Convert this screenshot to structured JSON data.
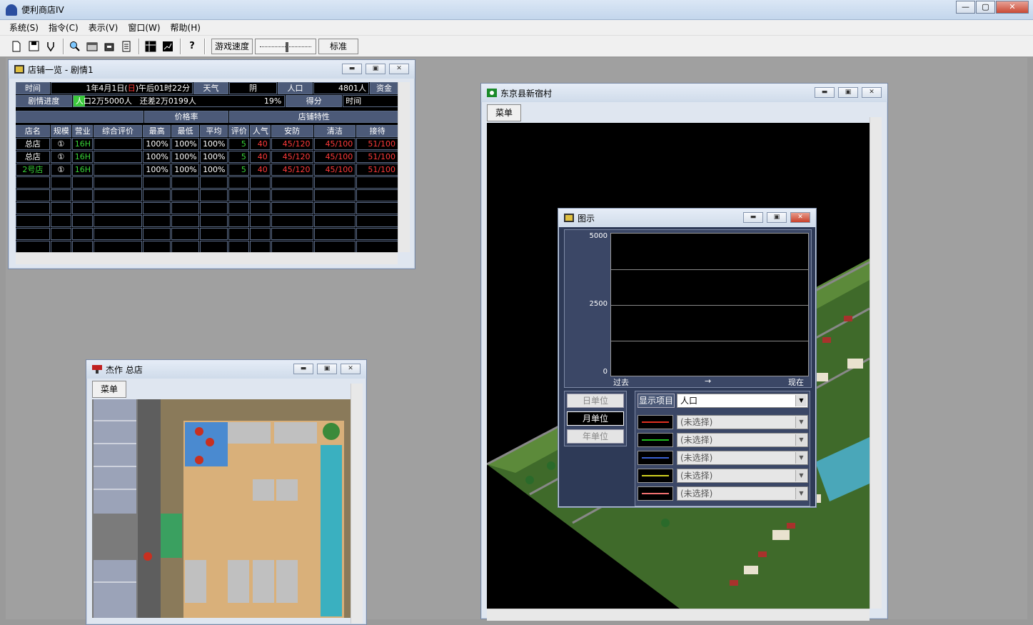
{
  "app": {
    "title": "便利商店IV",
    "window_buttons": [
      "—",
      "▢",
      "✕"
    ]
  },
  "menu": [
    "系统(S)",
    "指令(C)",
    "表示(V)",
    "窗口(W)",
    "帮助(H)"
  ],
  "toolbar": {
    "speed_label": "游戏速度",
    "speed_value": "标准",
    "speed_level": 0.5
  },
  "store_list": {
    "title": "店铺一览 - 剧情1",
    "row1": [
      "时间",
      "1年4月1日(",
      "日",
      ")午后01时22分",
      "天气",
      "阴",
      "人口",
      "4801人",
      "资金"
    ],
    "row2": {
      "label": "剧情进度",
      "progress_text": "人口2万5000人",
      "remain_text": "还差2万0199人",
      "percent": "19%",
      "score": "得分",
      "time": "时间",
      "progress_fraction": 0.19
    },
    "group_headers": [
      "价格率",
      "店铺特性"
    ],
    "columns": [
      "店名",
      "规模",
      "营业",
      "综合评价",
      "最高",
      "最低",
      "平均",
      "评价",
      "人气",
      "安防",
      "清洁",
      "接待"
    ],
    "rows": [
      [
        "总店",
        "①",
        "16H",
        "",
        "100%",
        "100%",
        "100%",
        "5",
        "40",
        "45/120",
        "45/100",
        "51/100"
      ],
      [
        "总店",
        "①",
        "16H",
        "",
        "100%",
        "100%",
        "100%",
        "5",
        "40",
        "45/120",
        "45/100",
        "51/100"
      ],
      [
        "2号店",
        "①",
        "16H",
        "",
        "100%",
        "100%",
        "100%",
        "5",
        "40",
        "45/120",
        "45/100",
        "51/100"
      ]
    ]
  },
  "map_window": {
    "title": "东京县新宿村",
    "menu_button": "菜单"
  },
  "shop_window": {
    "title": "杰作 总店",
    "menu_button": "菜单"
  },
  "graph_window": {
    "title": "图示",
    "x_start": "过去",
    "x_arrow": "→",
    "x_end": "现在",
    "units": [
      "日单位",
      "月单位",
      "年单位"
    ],
    "display_item_label": "显示项目",
    "display_item_value": "人口",
    "series_selects": [
      {
        "color": "#e03020",
        "value": "(未选择)"
      },
      {
        "color": "#20c020",
        "value": "(未选择)"
      },
      {
        "color": "#3a5fd0",
        "value": "(未选择)"
      },
      {
        "color": "#d0d020",
        "value": "(未选择)"
      },
      {
        "color": "#f07070",
        "value": "(未选择)"
      }
    ]
  },
  "chart_data": {
    "type": "line",
    "title": "",
    "xlabel": "",
    "ylabel": "",
    "yticks": [
      "5000",
      "2500",
      "0"
    ],
    "ylim": [
      0,
      5000
    ],
    "series": []
  }
}
